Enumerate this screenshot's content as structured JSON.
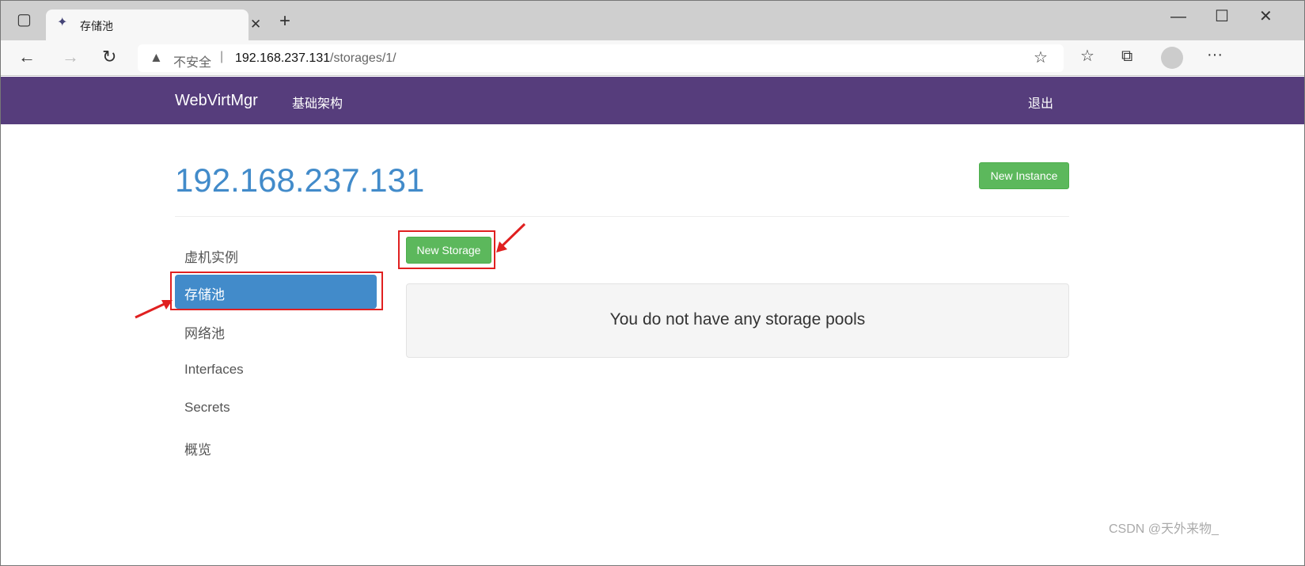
{
  "browser": {
    "tab_title": "存储池",
    "security_label": "不安全",
    "url_host": "192.168.237.131",
    "url_path": "/storages/1/"
  },
  "nav": {
    "brand": "WebVirtMgr",
    "infra": "基础架构",
    "logout": "退出"
  },
  "page": {
    "title": "192.168.237.131",
    "new_instance": "New Instance",
    "new_storage": "New Storage",
    "empty_message": "You do not have any storage pools"
  },
  "sidebar": {
    "items": [
      {
        "label": "虚机实例"
      },
      {
        "label": "存储池"
      },
      {
        "label": "网络池"
      },
      {
        "label": "Interfaces"
      },
      {
        "label": "Secrets"
      },
      {
        "label": "概览"
      }
    ]
  },
  "watermark": "CSDN @天外来物_"
}
